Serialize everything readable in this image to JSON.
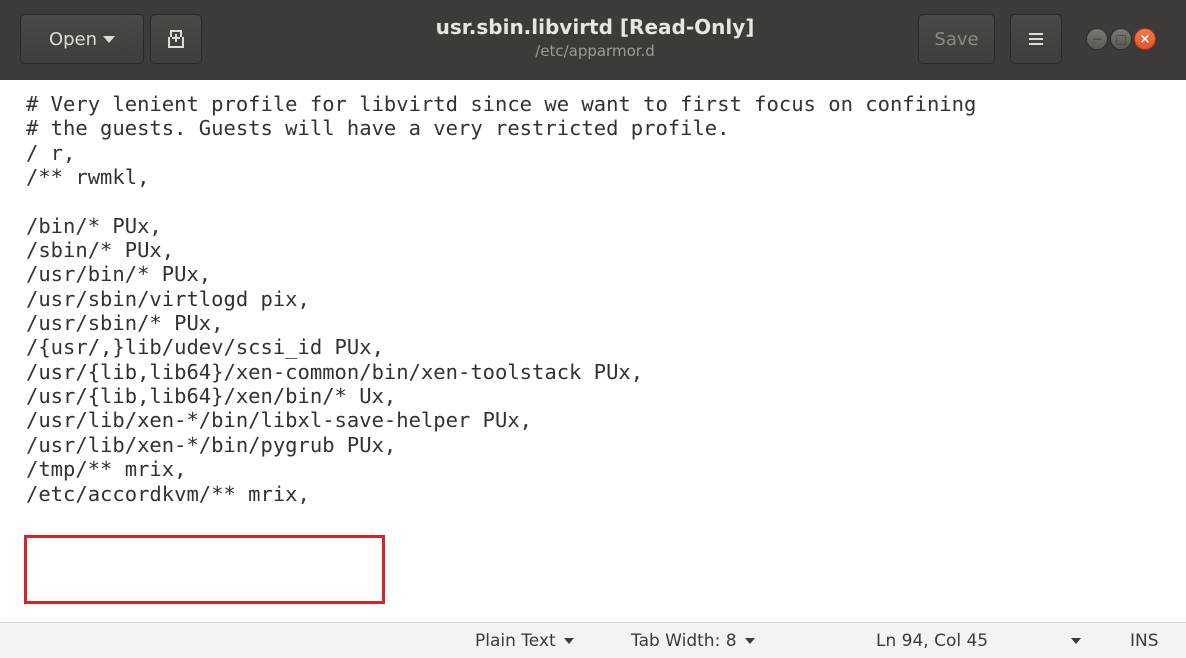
{
  "header": {
    "open_label": "Open",
    "title": "usr.sbin.libvirtd [Read-Only]",
    "subtitle": "/etc/apparmor.d",
    "save_label": "Save"
  },
  "editor": {
    "lines": [
      "# Very lenient profile for libvirtd since we want to first focus on confining",
      "# the guests. Guests will have a very restricted profile.",
      "/ r,",
      "/** rwmkl,",
      "",
      "/bin/* PUx,",
      "/sbin/* PUx,",
      "/usr/bin/* PUx,",
      "/usr/sbin/virtlogd pix,",
      "/usr/sbin/* PUx,",
      "/{usr/,}lib/udev/scsi_id PUx,",
      "/usr/{lib,lib64}/xen-common/bin/xen-toolstack PUx,",
      "/usr/{lib,lib64}/xen/bin/* Ux,",
      "/usr/lib/xen-*/bin/libxl-save-helper PUx,",
      "/usr/lib/xen-*/bin/pygrub PUx,",
      "/tmp/** mrix,",
      "/etc/accordkvm/** mrix,"
    ]
  },
  "statusbar": {
    "language": "Plain Text",
    "tab_width": "Tab Width: 8",
    "position": "Ln 94, Col 45",
    "mode": "INS"
  },
  "colors": {
    "header_bg": "#3c3b37",
    "close_button": "#e95420",
    "highlight_border": "#d32626"
  }
}
